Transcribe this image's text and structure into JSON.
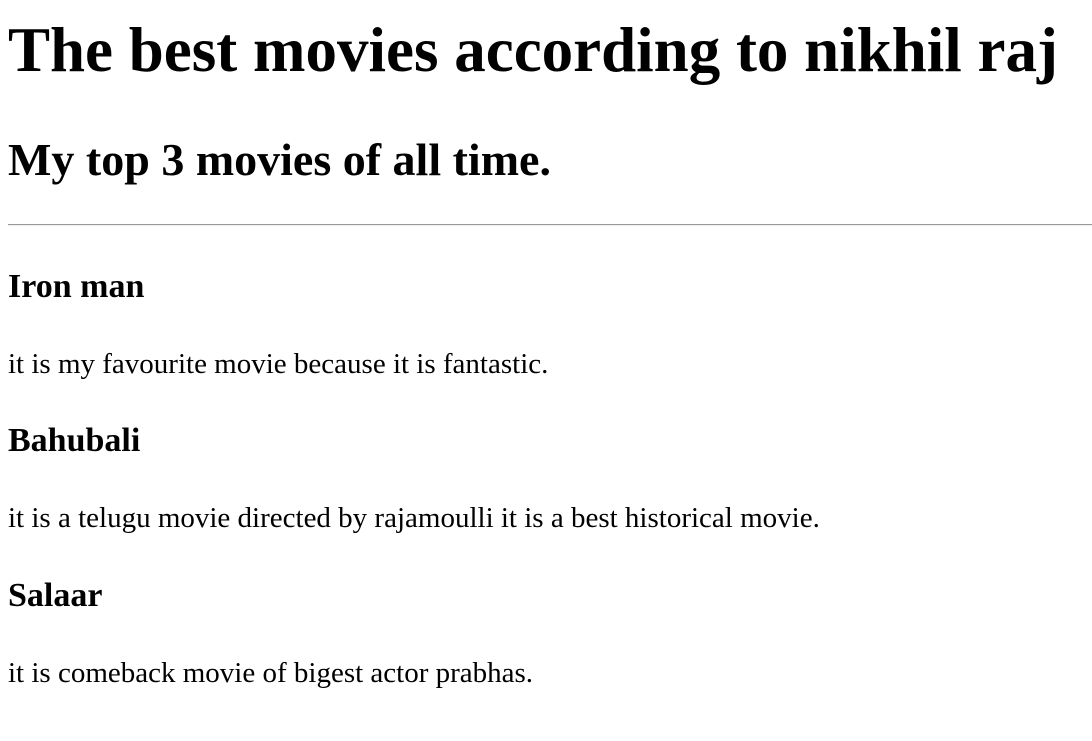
{
  "page": {
    "title": "The best movies according to nikhil raj",
    "subtitle": "My top 3 movies of all time."
  },
  "movies": [
    {
      "name": "Iron man",
      "description": "it is my favourite movie because it is fantastic."
    },
    {
      "name": "Bahubali",
      "description": "it is a telugu movie directed by rajamoulli it is a best historical movie."
    },
    {
      "name": "Salaar",
      "description": "it is comeback movie of bigest actor prabhas."
    }
  ]
}
